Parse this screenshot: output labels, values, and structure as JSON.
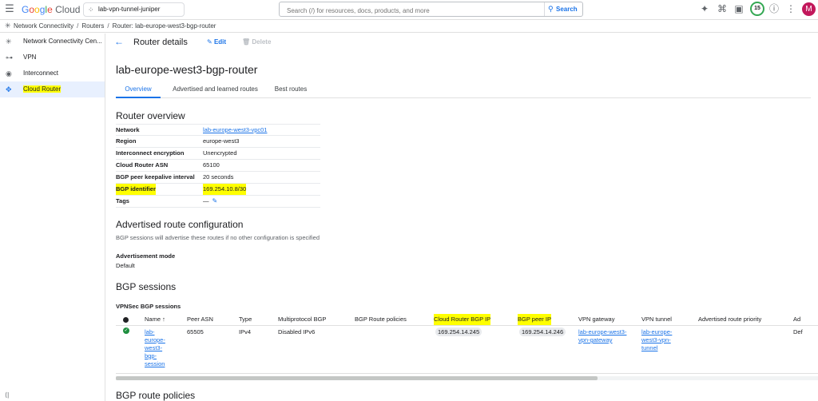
{
  "header": {
    "logo_google": [
      "G",
      "o",
      "o",
      "g",
      "l",
      "e"
    ],
    "logo_cloud": "Cloud",
    "project": "lab-vpn-tunnel-juniper",
    "search_placeholder": "Search (/) for resources, docs, products, and more",
    "search_button": "Search",
    "trial_count": "15",
    "avatar_letter": "M"
  },
  "breadcrumb": {
    "items": [
      "Network Connectivity",
      "Routers",
      "Router: lab-europe-west3-bgp-router"
    ]
  },
  "sidebar": {
    "items": [
      {
        "label": "Network Connectivity Cen...",
        "icon": "hub-icon",
        "active": false
      },
      {
        "label": "VPN",
        "icon": "vpn-icon",
        "active": false
      },
      {
        "label": "Interconnect",
        "icon": "interconnect-icon",
        "active": false
      },
      {
        "label": "Cloud Router",
        "icon": "router-icon",
        "active": true
      }
    ]
  },
  "toolbar": {
    "title": "Router details",
    "edit": "Edit",
    "delete": "Delete"
  },
  "main": {
    "title": "lab-europe-west3-bgp-router",
    "tabs": [
      "Overview",
      "Advertised and learned routes",
      "Best routes"
    ],
    "overview_heading": "Router overview",
    "overview": [
      {
        "key": "Network",
        "value": "lab-europe-west3-vpc01",
        "link": true
      },
      {
        "key": "Region",
        "value": "europe-west3"
      },
      {
        "key": "Interconnect encryption",
        "value": "Unencrypted"
      },
      {
        "key": "Cloud Router ASN",
        "value": "65100"
      },
      {
        "key": "BGP peer keepalive interval",
        "value": "20 seconds"
      },
      {
        "key": "BGP identifier",
        "value": "169.254.10.8/30"
      },
      {
        "key": "Tags",
        "value": "—"
      }
    ],
    "adv_heading": "Advertised route configuration",
    "adv_desc": "BGP sessions will advertise these routes if no other configuration is specified",
    "adv_mode_label": "Advertisement mode",
    "adv_mode_value": "Default",
    "bgp_heading": "BGP sessions",
    "vpn_sessions_label": "VPNSec BGP sessions",
    "bgp_policies_heading": "BGP route policies"
  },
  "table": {
    "columns": [
      "Name",
      "Peer ASN",
      "Type",
      "Multiprotocol BGP",
      "BGP Route policies",
      "Cloud Router BGP IP",
      "BGP peer IP",
      "VPN gateway",
      "VPN tunnel",
      "Advertised route priority",
      "Ad"
    ],
    "row": {
      "name_lines": [
        "lab-",
        "europe-",
        "west3-",
        "bgp-",
        "session"
      ],
      "peer_asn": "65505",
      "type": "IPv4",
      "multiprotocol": "Disabled IPv6",
      "policies": "",
      "cloud_router_ip": "169.254.14.245",
      "peer_ip": "169.254.14.246",
      "vpn_gateway_lines": [
        "lab-europe-west3-",
        "vpn-gateway"
      ],
      "vpn_tunnel_lines": [
        "lab-europe-",
        "west3-vpn-",
        "tunnel"
      ],
      "priority": "",
      "ad": "Def"
    }
  },
  "colors": {
    "accent": "#1a73e8",
    "highlight": "#ffff00",
    "status_ok": "#1e8e3e"
  }
}
